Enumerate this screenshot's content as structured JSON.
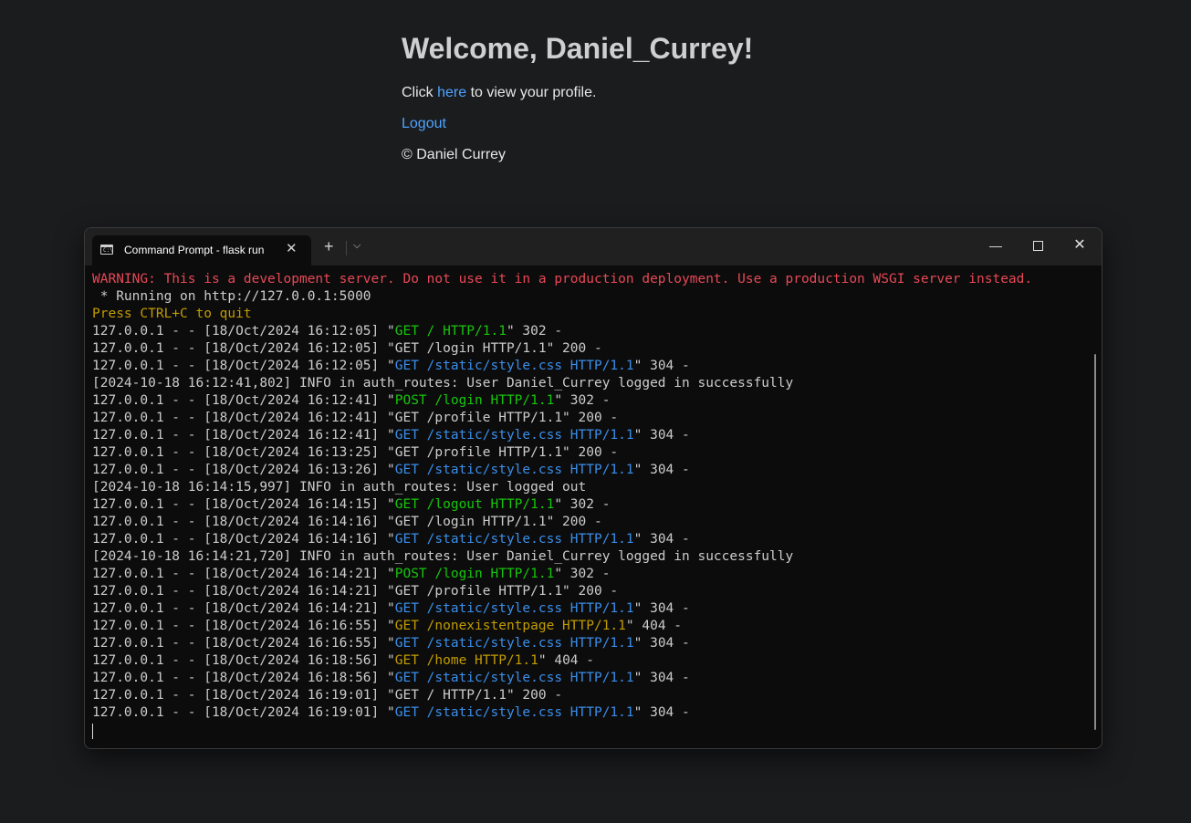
{
  "page": {
    "heading": "Welcome, Daniel_Currey!",
    "click_prefix": "Click ",
    "here_link": "here",
    "click_suffix": " to view your profile.",
    "logout_link": "Logout",
    "footer": "© Daniel Currey"
  },
  "terminal": {
    "tab_title": "Command Prompt - flask  run",
    "icon_text": "C:\\",
    "lines": [
      [
        {
          "t": "WARNING: This is a development server. Do not use it in a production deployment. Use a production WSGI server instead.",
          "c": "red"
        }
      ],
      [
        {
          "t": " * Running on http://127.0.0.1:5000",
          "c": ""
        }
      ],
      [
        {
          "t": "Press CTRL+C to quit",
          "c": "yel"
        }
      ],
      [
        {
          "t": "127.0.0.1 - - [18/Oct/2024 16:12:05] \"",
          "c": ""
        },
        {
          "t": "GET / HTTP/1.1",
          "c": "grn"
        },
        {
          "t": "\" 302 -",
          "c": ""
        }
      ],
      [
        {
          "t": "127.0.0.1 - - [18/Oct/2024 16:12:05] \"GET /login HTTP/1.1\" 200 -",
          "c": ""
        }
      ],
      [
        {
          "t": "127.0.0.1 - - [18/Oct/2024 16:12:05] \"",
          "c": ""
        },
        {
          "t": "GET /static/style.css HTTP/1.1",
          "c": "blu"
        },
        {
          "t": "\" 304 -",
          "c": ""
        }
      ],
      [
        {
          "t": "[2024-10-18 16:12:41,802] INFO in auth_routes: User Daniel_Currey logged in successfully",
          "c": ""
        }
      ],
      [
        {
          "t": "127.0.0.1 - - [18/Oct/2024 16:12:41] \"",
          "c": ""
        },
        {
          "t": "POST /login HTTP/1.1",
          "c": "grn"
        },
        {
          "t": "\" 302 -",
          "c": ""
        }
      ],
      [
        {
          "t": "127.0.0.1 - - [18/Oct/2024 16:12:41] \"GET /profile HTTP/1.1\" 200 -",
          "c": ""
        }
      ],
      [
        {
          "t": "127.0.0.1 - - [18/Oct/2024 16:12:41] \"",
          "c": ""
        },
        {
          "t": "GET /static/style.css HTTP/1.1",
          "c": "blu"
        },
        {
          "t": "\" 304 -",
          "c": ""
        }
      ],
      [
        {
          "t": "127.0.0.1 - - [18/Oct/2024 16:13:25] \"GET /profile HTTP/1.1\" 200 -",
          "c": ""
        }
      ],
      [
        {
          "t": "127.0.0.1 - - [18/Oct/2024 16:13:26] \"",
          "c": ""
        },
        {
          "t": "GET /static/style.css HTTP/1.1",
          "c": "blu"
        },
        {
          "t": "\" 304 -",
          "c": ""
        }
      ],
      [
        {
          "t": "[2024-10-18 16:14:15,997] INFO in auth_routes: User logged out",
          "c": ""
        }
      ],
      [
        {
          "t": "127.0.0.1 - - [18/Oct/2024 16:14:15] \"",
          "c": ""
        },
        {
          "t": "GET /logout HTTP/1.1",
          "c": "grn"
        },
        {
          "t": "\" 302 -",
          "c": ""
        }
      ],
      [
        {
          "t": "127.0.0.1 - - [18/Oct/2024 16:14:16] \"GET /login HTTP/1.1\" 200 -",
          "c": ""
        }
      ],
      [
        {
          "t": "127.0.0.1 - - [18/Oct/2024 16:14:16] \"",
          "c": ""
        },
        {
          "t": "GET /static/style.css HTTP/1.1",
          "c": "blu"
        },
        {
          "t": "\" 304 -",
          "c": ""
        }
      ],
      [
        {
          "t": "[2024-10-18 16:14:21,720] INFO in auth_routes: User Daniel_Currey logged in successfully",
          "c": ""
        }
      ],
      [
        {
          "t": "127.0.0.1 - - [18/Oct/2024 16:14:21] \"",
          "c": ""
        },
        {
          "t": "POST /login HTTP/1.1",
          "c": "grn"
        },
        {
          "t": "\" 302 -",
          "c": ""
        }
      ],
      [
        {
          "t": "127.0.0.1 - - [18/Oct/2024 16:14:21] \"GET /profile HTTP/1.1\" 200 -",
          "c": ""
        }
      ],
      [
        {
          "t": "127.0.0.1 - - [18/Oct/2024 16:14:21] \"",
          "c": ""
        },
        {
          "t": "GET /static/style.css HTTP/1.1",
          "c": "blu"
        },
        {
          "t": "\" 304 -",
          "c": ""
        }
      ],
      [
        {
          "t": "127.0.0.1 - - [18/Oct/2024 16:16:55] \"",
          "c": ""
        },
        {
          "t": "GET /nonexistentpage HTTP/1.1",
          "c": "yel"
        },
        {
          "t": "\" 404 -",
          "c": ""
        }
      ],
      [
        {
          "t": "127.0.0.1 - - [18/Oct/2024 16:16:55] \"",
          "c": ""
        },
        {
          "t": "GET /static/style.css HTTP/1.1",
          "c": "blu"
        },
        {
          "t": "\" 304 -",
          "c": ""
        }
      ],
      [
        {
          "t": "127.0.0.1 - - [18/Oct/2024 16:18:56] \"",
          "c": ""
        },
        {
          "t": "GET /home HTTP/1.1",
          "c": "yel"
        },
        {
          "t": "\" 404 -",
          "c": ""
        }
      ],
      [
        {
          "t": "127.0.0.1 - - [18/Oct/2024 16:18:56] \"",
          "c": ""
        },
        {
          "t": "GET /static/style.css HTTP/1.1",
          "c": "blu"
        },
        {
          "t": "\" 304 -",
          "c": ""
        }
      ],
      [
        {
          "t": "127.0.0.1 - - [18/Oct/2024 16:19:01] \"GET / HTTP/1.1\" 200 -",
          "c": ""
        }
      ],
      [
        {
          "t": "127.0.0.1 - - [18/Oct/2024 16:19:01] \"",
          "c": ""
        },
        {
          "t": "GET /static/style.css HTTP/1.1",
          "c": "blu"
        },
        {
          "t": "\" 304 -",
          "c": ""
        }
      ]
    ]
  },
  "colors": {
    "background": "#1b1c1e",
    "link": "#4ea3ff",
    "terminal_bg": "#0c0c0c",
    "warning": "#e74856",
    "yellow": "#c19c00",
    "green": "#16c60c",
    "blue": "#3b8eea"
  },
  "icons": {
    "tab_icon": "command-prompt-icon",
    "tab_close": "close-icon",
    "new_tab": "plus-icon",
    "dropdown": "chevron-down-icon",
    "minimize": "minimize-icon",
    "maximize": "maximize-icon",
    "close": "close-icon"
  }
}
